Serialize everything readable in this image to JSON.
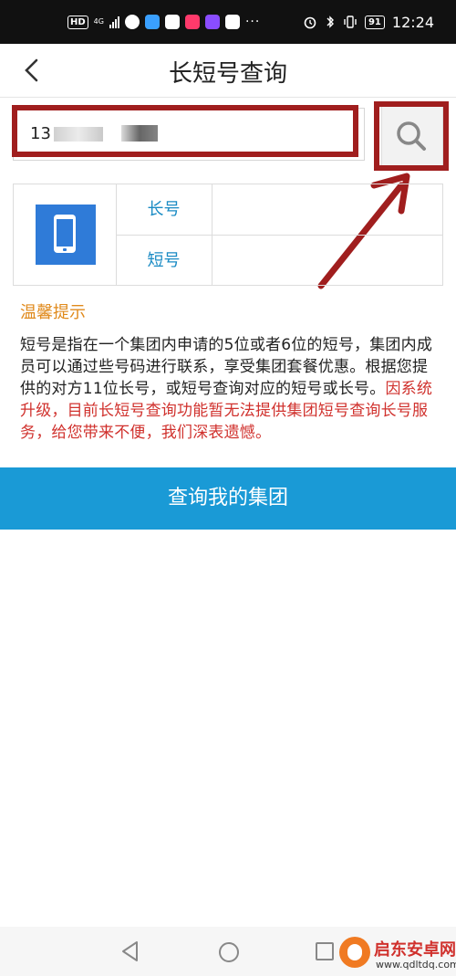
{
  "status_bar": {
    "left_badge": "HD",
    "network": "4G",
    "dots": "···",
    "battery": "91",
    "time": "12:24"
  },
  "header": {
    "title": "长短号查询"
  },
  "search": {
    "value": "13"
  },
  "table": {
    "long_label": "长号",
    "short_label": "短号",
    "long_value": "",
    "short_value": ""
  },
  "tips": {
    "title": "温馨提示",
    "text_normal": "短号是指在一个集团内申请的5位或者6位的短号，集团内成员可以通过些号码进行联系，享受集团套餐优惠。根据您提供的对方11位长号，或短号查询对应的短号或长号。",
    "text_red": "因系统升级，目前长短号查询功能暂无法提供集团短号查询长号服务，给您带来不便，我们深表遗憾。"
  },
  "actions": {
    "query_group": "查询我的集团"
  },
  "watermark": {
    "name": "启东安卓网",
    "url": "www.qdltdq.com"
  },
  "colors": {
    "accent": "#1a9ad6",
    "label_blue": "#1a8bc4",
    "tip_orange": "#e08a1c",
    "warning_red": "#d0312d",
    "annotation_red": "#a01e1e"
  }
}
